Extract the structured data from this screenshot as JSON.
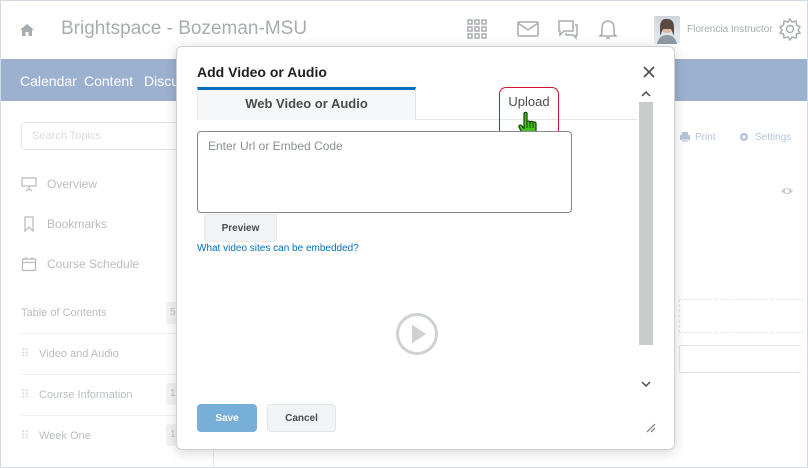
{
  "header": {
    "org_title": "Brightspace - Bozeman-MSU",
    "user_name": "Florencia Instructor"
  },
  "navbar": {
    "items": [
      "Calendar",
      "Content",
      "Discu"
    ]
  },
  "sidebar": {
    "search_placeholder": "Search Topics",
    "links": [
      "Overview",
      "Bookmarks",
      "Course Schedule"
    ],
    "toc_label": "Table of Contents",
    "toc_count": "5",
    "modules": [
      {
        "label": "Video and Audio",
        "count": ""
      },
      {
        "label": "Course Information",
        "count": "1"
      },
      {
        "label": "Week One",
        "count": "1"
      }
    ]
  },
  "content_tools": {
    "print_label": "Print",
    "settings_label": "Settings"
  },
  "modal": {
    "title": "Add Video or Audio",
    "tabs": {
      "web": "Web Video or Audio",
      "upload": "Upload"
    },
    "url_placeholder": "Enter Url or Embed Code",
    "preview_label": "Preview",
    "help_link": "What video sites can be embedded?",
    "save_label": "Save",
    "cancel_label": "Cancel"
  },
  "colors": {
    "navbar": "#9cb1cf",
    "tab_accent": "#006fbf",
    "highlight": "#d0132f",
    "save_button": "#77afd9",
    "cursor": "#44c31b"
  }
}
